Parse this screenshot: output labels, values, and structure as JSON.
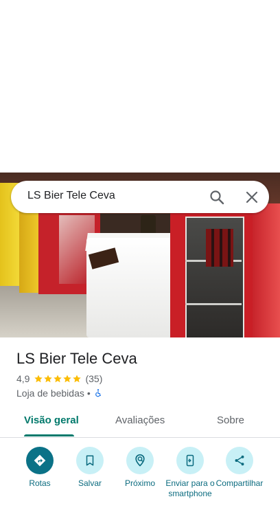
{
  "search": {
    "query": "LS Bier Tele Ceva"
  },
  "place": {
    "name": "LS Bier Tele Ceva",
    "rating": "4,9",
    "stars": 5,
    "review_count": "(35)",
    "category": "Loja de bebidas",
    "separator": "•"
  },
  "tabs": [
    {
      "label": "Visão geral",
      "selected": true
    },
    {
      "label": "Avaliações",
      "selected": false
    },
    {
      "label": "Sobre",
      "selected": false
    }
  ],
  "actions": [
    {
      "label": "Rotas",
      "icon": "directions-icon"
    },
    {
      "label": "Salvar",
      "icon": "bookmark-icon"
    },
    {
      "label": "Próximo",
      "icon": "nearby-icon"
    },
    {
      "label": "Enviar para o smartphone",
      "icon": "send-to-phone-icon"
    },
    {
      "label": "Compartilhar",
      "icon": "share-icon"
    }
  ],
  "colors": {
    "accent": "#00796b",
    "primary_action": "#0b7287",
    "action_bg": "#c8f0f6",
    "star": "#fbbc04"
  }
}
